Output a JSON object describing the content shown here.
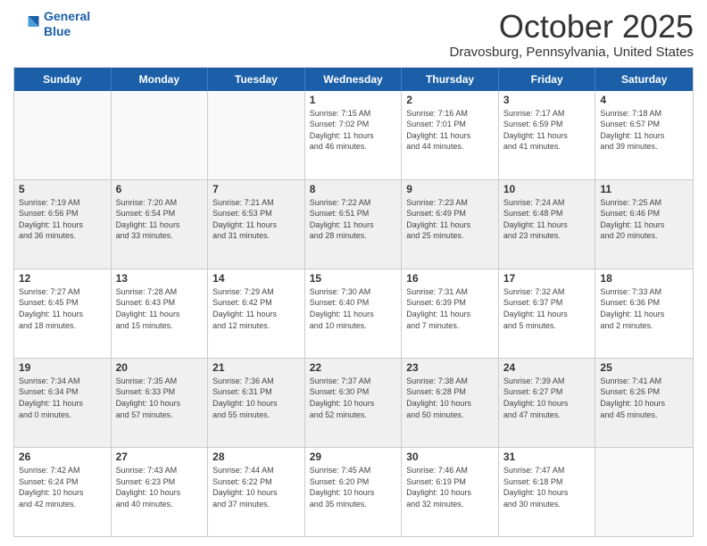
{
  "header": {
    "logo_line1": "General",
    "logo_line2": "Blue",
    "month_title": "October 2025",
    "location": "Dravosburg, Pennsylvania, United States"
  },
  "weekdays": [
    "Sunday",
    "Monday",
    "Tuesday",
    "Wednesday",
    "Thursday",
    "Friday",
    "Saturday"
  ],
  "rows": [
    [
      {
        "day": "",
        "info": "",
        "empty": true
      },
      {
        "day": "",
        "info": "",
        "empty": true
      },
      {
        "day": "",
        "info": "",
        "empty": true
      },
      {
        "day": "1",
        "info": "Sunrise: 7:15 AM\nSunset: 7:02 PM\nDaylight: 11 hours\nand 46 minutes."
      },
      {
        "day": "2",
        "info": "Sunrise: 7:16 AM\nSunset: 7:01 PM\nDaylight: 11 hours\nand 44 minutes."
      },
      {
        "day": "3",
        "info": "Sunrise: 7:17 AM\nSunset: 6:59 PM\nDaylight: 11 hours\nand 41 minutes."
      },
      {
        "day": "4",
        "info": "Sunrise: 7:18 AM\nSunset: 6:57 PM\nDaylight: 11 hours\nand 39 minutes."
      }
    ],
    [
      {
        "day": "5",
        "info": "Sunrise: 7:19 AM\nSunset: 6:56 PM\nDaylight: 11 hours\nand 36 minutes.",
        "shaded": true
      },
      {
        "day": "6",
        "info": "Sunrise: 7:20 AM\nSunset: 6:54 PM\nDaylight: 11 hours\nand 33 minutes.",
        "shaded": true
      },
      {
        "day": "7",
        "info": "Sunrise: 7:21 AM\nSunset: 6:53 PM\nDaylight: 11 hours\nand 31 minutes.",
        "shaded": true
      },
      {
        "day": "8",
        "info": "Sunrise: 7:22 AM\nSunset: 6:51 PM\nDaylight: 11 hours\nand 28 minutes.",
        "shaded": true
      },
      {
        "day": "9",
        "info": "Sunrise: 7:23 AM\nSunset: 6:49 PM\nDaylight: 11 hours\nand 25 minutes.",
        "shaded": true
      },
      {
        "day": "10",
        "info": "Sunrise: 7:24 AM\nSunset: 6:48 PM\nDaylight: 11 hours\nand 23 minutes.",
        "shaded": true
      },
      {
        "day": "11",
        "info": "Sunrise: 7:25 AM\nSunset: 6:46 PM\nDaylight: 11 hours\nand 20 minutes.",
        "shaded": true
      }
    ],
    [
      {
        "day": "12",
        "info": "Sunrise: 7:27 AM\nSunset: 6:45 PM\nDaylight: 11 hours\nand 18 minutes."
      },
      {
        "day": "13",
        "info": "Sunrise: 7:28 AM\nSunset: 6:43 PM\nDaylight: 11 hours\nand 15 minutes."
      },
      {
        "day": "14",
        "info": "Sunrise: 7:29 AM\nSunset: 6:42 PM\nDaylight: 11 hours\nand 12 minutes."
      },
      {
        "day": "15",
        "info": "Sunrise: 7:30 AM\nSunset: 6:40 PM\nDaylight: 11 hours\nand 10 minutes."
      },
      {
        "day": "16",
        "info": "Sunrise: 7:31 AM\nSunset: 6:39 PM\nDaylight: 11 hours\nand 7 minutes."
      },
      {
        "day": "17",
        "info": "Sunrise: 7:32 AM\nSunset: 6:37 PM\nDaylight: 11 hours\nand 5 minutes."
      },
      {
        "day": "18",
        "info": "Sunrise: 7:33 AM\nSunset: 6:36 PM\nDaylight: 11 hours\nand 2 minutes."
      }
    ],
    [
      {
        "day": "19",
        "info": "Sunrise: 7:34 AM\nSunset: 6:34 PM\nDaylight: 11 hours\nand 0 minutes.",
        "shaded": true
      },
      {
        "day": "20",
        "info": "Sunrise: 7:35 AM\nSunset: 6:33 PM\nDaylight: 10 hours\nand 57 minutes.",
        "shaded": true
      },
      {
        "day": "21",
        "info": "Sunrise: 7:36 AM\nSunset: 6:31 PM\nDaylight: 10 hours\nand 55 minutes.",
        "shaded": true
      },
      {
        "day": "22",
        "info": "Sunrise: 7:37 AM\nSunset: 6:30 PM\nDaylight: 10 hours\nand 52 minutes.",
        "shaded": true
      },
      {
        "day": "23",
        "info": "Sunrise: 7:38 AM\nSunset: 6:28 PM\nDaylight: 10 hours\nand 50 minutes.",
        "shaded": true
      },
      {
        "day": "24",
        "info": "Sunrise: 7:39 AM\nSunset: 6:27 PM\nDaylight: 10 hours\nand 47 minutes.",
        "shaded": true
      },
      {
        "day": "25",
        "info": "Sunrise: 7:41 AM\nSunset: 6:26 PM\nDaylight: 10 hours\nand 45 minutes.",
        "shaded": true
      }
    ],
    [
      {
        "day": "26",
        "info": "Sunrise: 7:42 AM\nSunset: 6:24 PM\nDaylight: 10 hours\nand 42 minutes."
      },
      {
        "day": "27",
        "info": "Sunrise: 7:43 AM\nSunset: 6:23 PM\nDaylight: 10 hours\nand 40 minutes."
      },
      {
        "day": "28",
        "info": "Sunrise: 7:44 AM\nSunset: 6:22 PM\nDaylight: 10 hours\nand 37 minutes."
      },
      {
        "day": "29",
        "info": "Sunrise: 7:45 AM\nSunset: 6:20 PM\nDaylight: 10 hours\nand 35 minutes."
      },
      {
        "day": "30",
        "info": "Sunrise: 7:46 AM\nSunset: 6:19 PM\nDaylight: 10 hours\nand 32 minutes."
      },
      {
        "day": "31",
        "info": "Sunrise: 7:47 AM\nSunset: 6:18 PM\nDaylight: 10 hours\nand 30 minutes."
      },
      {
        "day": "",
        "info": "",
        "empty": true
      }
    ]
  ]
}
